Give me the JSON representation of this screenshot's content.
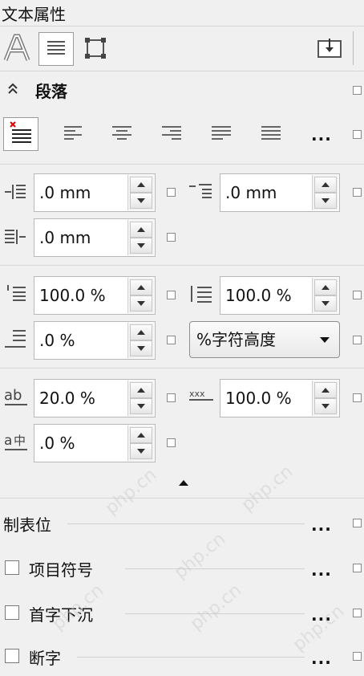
{
  "panel": {
    "title": "文本属性"
  },
  "section": {
    "title": "段落"
  },
  "indent": {
    "first_line": ".0 mm",
    "left": ".0 mm",
    "right": ".0 mm"
  },
  "spacing": {
    "before_paragraph": "100.0 %",
    "line": "100.0 %",
    "after_paragraph": ".0 %",
    "unit_dropdown": "%字符高度"
  },
  "chars": {
    "char_spacing": "20.0 %",
    "word_spacing": "100.0 %",
    "language_spacing": ".0 %"
  },
  "options": {
    "tabs_label": "制表位",
    "bullets_label": "项目符号",
    "dropcap_label": "首字下沉",
    "hyphenate_label": "断字"
  },
  "more_label": "...",
  "watermark": "php.cn"
}
